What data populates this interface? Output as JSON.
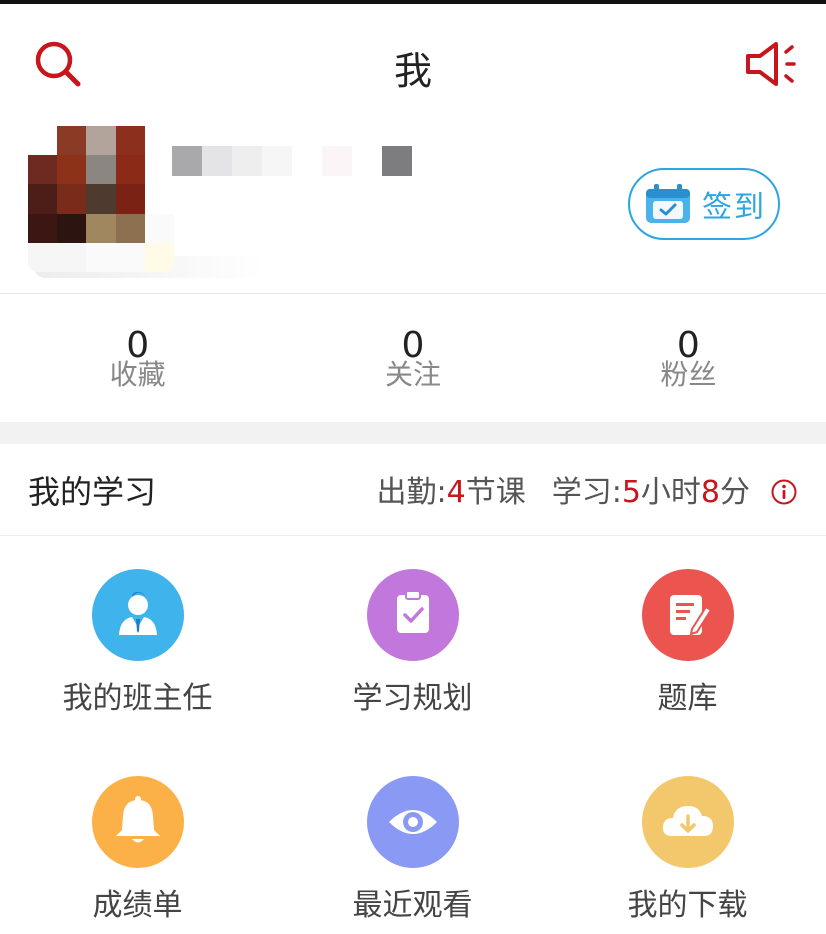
{
  "header": {
    "title": "我",
    "search_icon": "search-icon",
    "announce_icon": "megaphone-icon"
  },
  "profile": {
    "checkin_label": "签到",
    "checkin_icon": "calendar-check-icon"
  },
  "stats": [
    {
      "value": "0",
      "label": "收藏"
    },
    {
      "value": "0",
      "label": "关注"
    },
    {
      "value": "0",
      "label": "粉丝"
    }
  ],
  "study": {
    "title": "我的学习",
    "attendance_prefix": "出勤:",
    "attendance_value": "4",
    "attendance_unit": "节课",
    "time_prefix": "学习:",
    "hours_value": "5",
    "hours_unit": "小时",
    "minutes_value": "8",
    "minutes_unit": "分",
    "info_icon": "info-icon"
  },
  "tiles": [
    {
      "label": "我的班主任",
      "icon": "teacher-icon",
      "color": "#3fb3ec"
    },
    {
      "label": "学习规划",
      "icon": "clipboard-check-icon",
      "color": "#c277dc"
    },
    {
      "label": "题库",
      "icon": "edit-document-icon",
      "color": "#ec5450"
    },
    {
      "label": "成绩单",
      "icon": "bell-icon",
      "color": "#fbb147"
    },
    {
      "label": "最近观看",
      "icon": "eye-icon",
      "color": "#8a9af4"
    },
    {
      "label": "我的下载",
      "icon": "cloud-download-icon",
      "color": "#f3c86c"
    }
  ],
  "colors": {
    "brand_red": "#c8161d",
    "checkin_blue": "#2aa6e0"
  }
}
